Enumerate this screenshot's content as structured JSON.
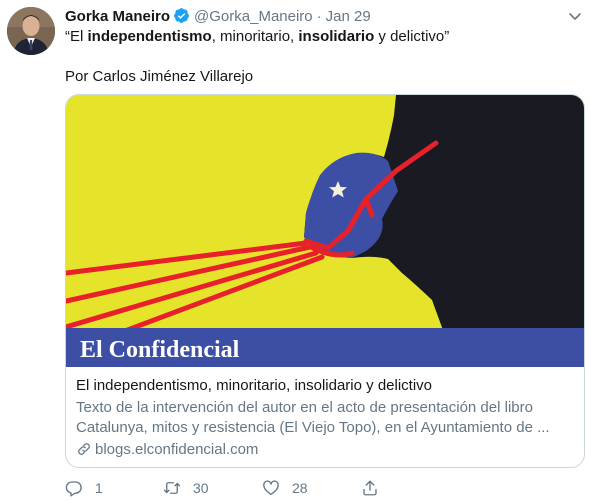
{
  "author": {
    "name": "Gorka Maneiro",
    "handle": "@Gorka_Maneiro",
    "separator": "·",
    "date": "Jan 29",
    "verified": true
  },
  "tweet": {
    "quote_open": "“El ",
    "bold1": "independentismo",
    "mid1": ", minoritario, ",
    "bold2": "insolidario",
    "mid2": " y delictivo”",
    "byline": "Por Carlos Jiménez Villarejo"
  },
  "card": {
    "image_masthead": "El Confidencial",
    "title": "El independentismo, minoritario, insolidario y delictivo",
    "description": "Texto de la intervención del autor en el acto de presentación del libro Catalunya, mitos y resistencia (El Viejo Topo), en el Ayuntamiento de ...",
    "domain": "blogs.elconfidencial.com"
  },
  "actions": {
    "reply_count": "1",
    "retweet_count": "30",
    "like_count": "28"
  },
  "colors": {
    "text_primary": "#14171a",
    "text_secondary": "#657786",
    "verified_blue": "#1da1f2",
    "card_border": "#ccd6dd",
    "image_yellow": "#e6e42a",
    "masthead_blue": "#3d4fa5",
    "rope_red": "#e8202a"
  },
  "icons": [
    "verified-badge-icon",
    "chevron-down-icon",
    "link-icon",
    "reply-icon",
    "retweet-icon",
    "like-icon",
    "share-icon",
    "star-icon"
  ]
}
